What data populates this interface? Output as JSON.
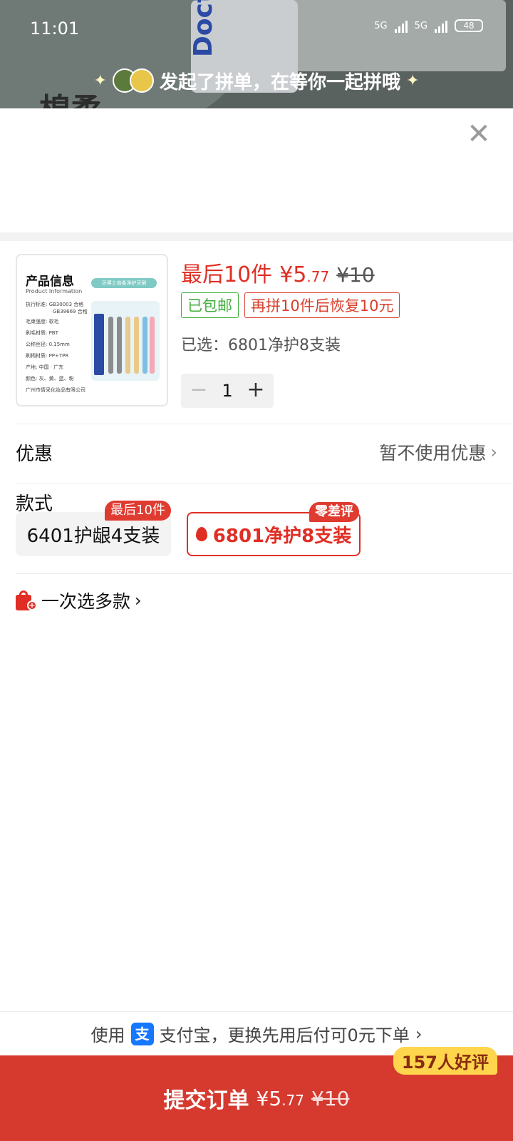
{
  "status_bar": {
    "time": "11:01",
    "network1": "5G",
    "network2": "5G",
    "battery": "48"
  },
  "background": {
    "brand_text": "Doctor",
    "partial_text": "棉柔"
  },
  "group_banner": {
    "text": "发起了拼单，在等你一起拼哦"
  },
  "product": {
    "thumbnail": {
      "title": "产品信息",
      "subtitle": "Product Information",
      "tag": "牙博士倍柔净护牙刷",
      "lines": [
        "执行标准: GB30003 合格",
        "GB39669 合格",
        "毛束强度: 软毛",
        "刷毛材质: PBT",
        "公称丝径: 0.15mm",
        "刷柄材质: PP+TPR",
        "产地: 中国 · 广东",
        "颜色: 灰、黄、蓝、粉",
        "广州市倩采化妆品有限公司"
      ]
    },
    "last_pieces": "最后10件",
    "price_symbol": "¥",
    "price_int": "5",
    "price_dec": ".77",
    "original_price": "¥10",
    "tag_free_shipping": "已包邮",
    "tag_restore": "再拼10件后恢复10元",
    "selected_text": "已选：6801净护8支装",
    "quantity": "1"
  },
  "coupon": {
    "label": "优惠",
    "value": "暂不使用优惠"
  },
  "style": {
    "label": "款式",
    "options": [
      {
        "label": "6401护龈4支装",
        "badge": "最后10件"
      },
      {
        "label": "6801净护8支装",
        "badge": "零差评"
      }
    ]
  },
  "multi_select": {
    "label": "一次选多款"
  },
  "payment": {
    "prefix": "使用",
    "icon_text": "支",
    "text": "支付宝，更换先用后付可0元下单"
  },
  "submit": {
    "label": "提交订单",
    "price_symbol": "¥",
    "price_int": "5",
    "price_dec": ".77",
    "original_price": "¥10",
    "badge": "157人好评"
  },
  "colors": {
    "accent": "#e02e24",
    "submit_bg": "#d63a2f",
    "green": "#3fae3a",
    "badge_yellow": "#ffd54d"
  }
}
